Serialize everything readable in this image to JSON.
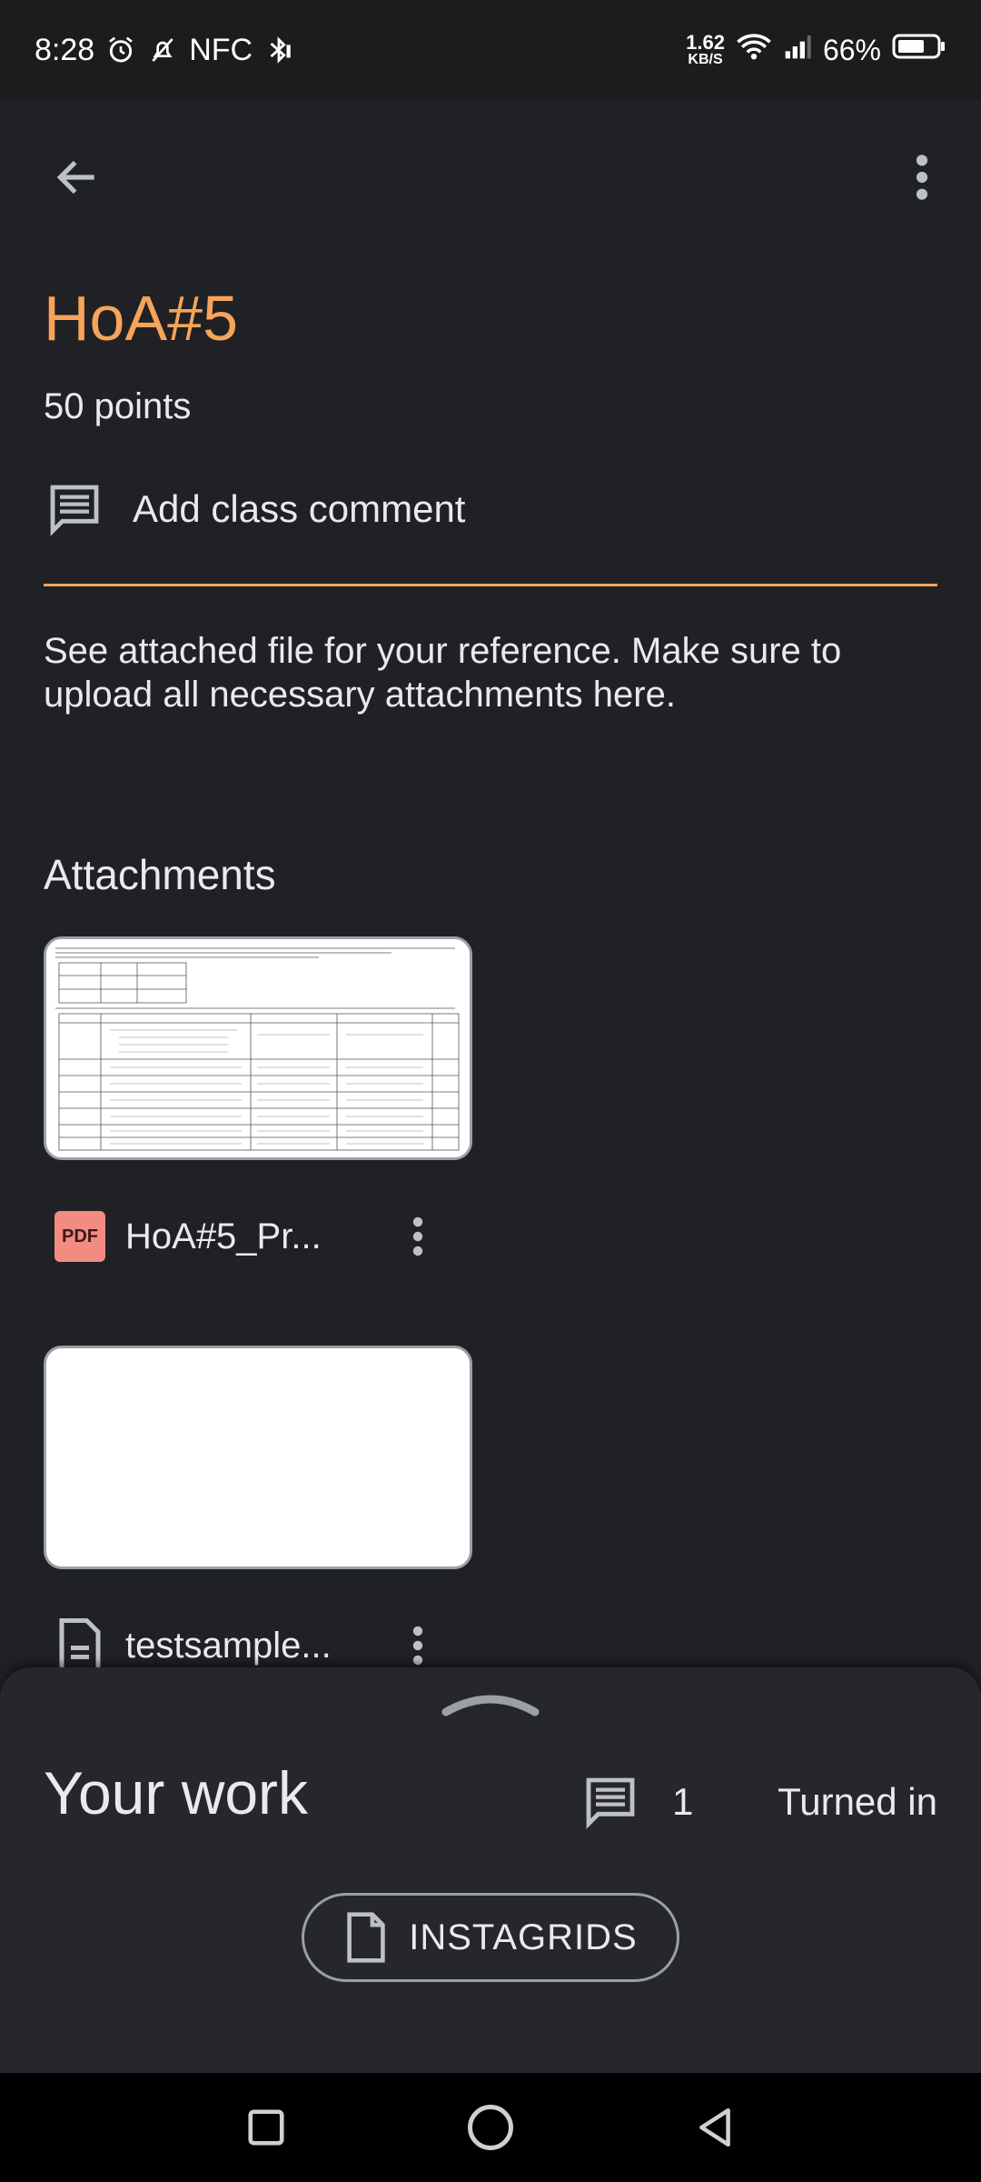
{
  "status_bar": {
    "time": "8:28",
    "nfc": "NFC",
    "speed_value": "1.62",
    "speed_unit": "KB/S",
    "battery": "66%",
    "icons": [
      "alarm-icon",
      "mute-icon",
      "bluetooth-icon",
      "wifi-icon",
      "signal-icon",
      "battery-icon"
    ]
  },
  "app_bar": {
    "back_icon": "arrow-back-icon",
    "more_icon": "more-vert-icon"
  },
  "assignment": {
    "title": "HoA#5",
    "points": "50 points",
    "add_comment": "Add class comment",
    "description": "See attached file for your reference. Make sure to upload all necessary attachments here."
  },
  "attachments": {
    "heading": "Attachments",
    "items": [
      {
        "type_label": "PDF",
        "name": "HoA#5_Pr..."
      },
      {
        "type_label": "",
        "name": "testsample..."
      }
    ]
  },
  "your_work": {
    "title": "Your work",
    "comment_count": "1",
    "status": "Turned in",
    "attachment_label": "INSTAGRIDS"
  },
  "colors": {
    "accent": "#f6a45a",
    "background": "#202124",
    "sheet": "#26272a",
    "pdf_badge": "#f28b82"
  }
}
